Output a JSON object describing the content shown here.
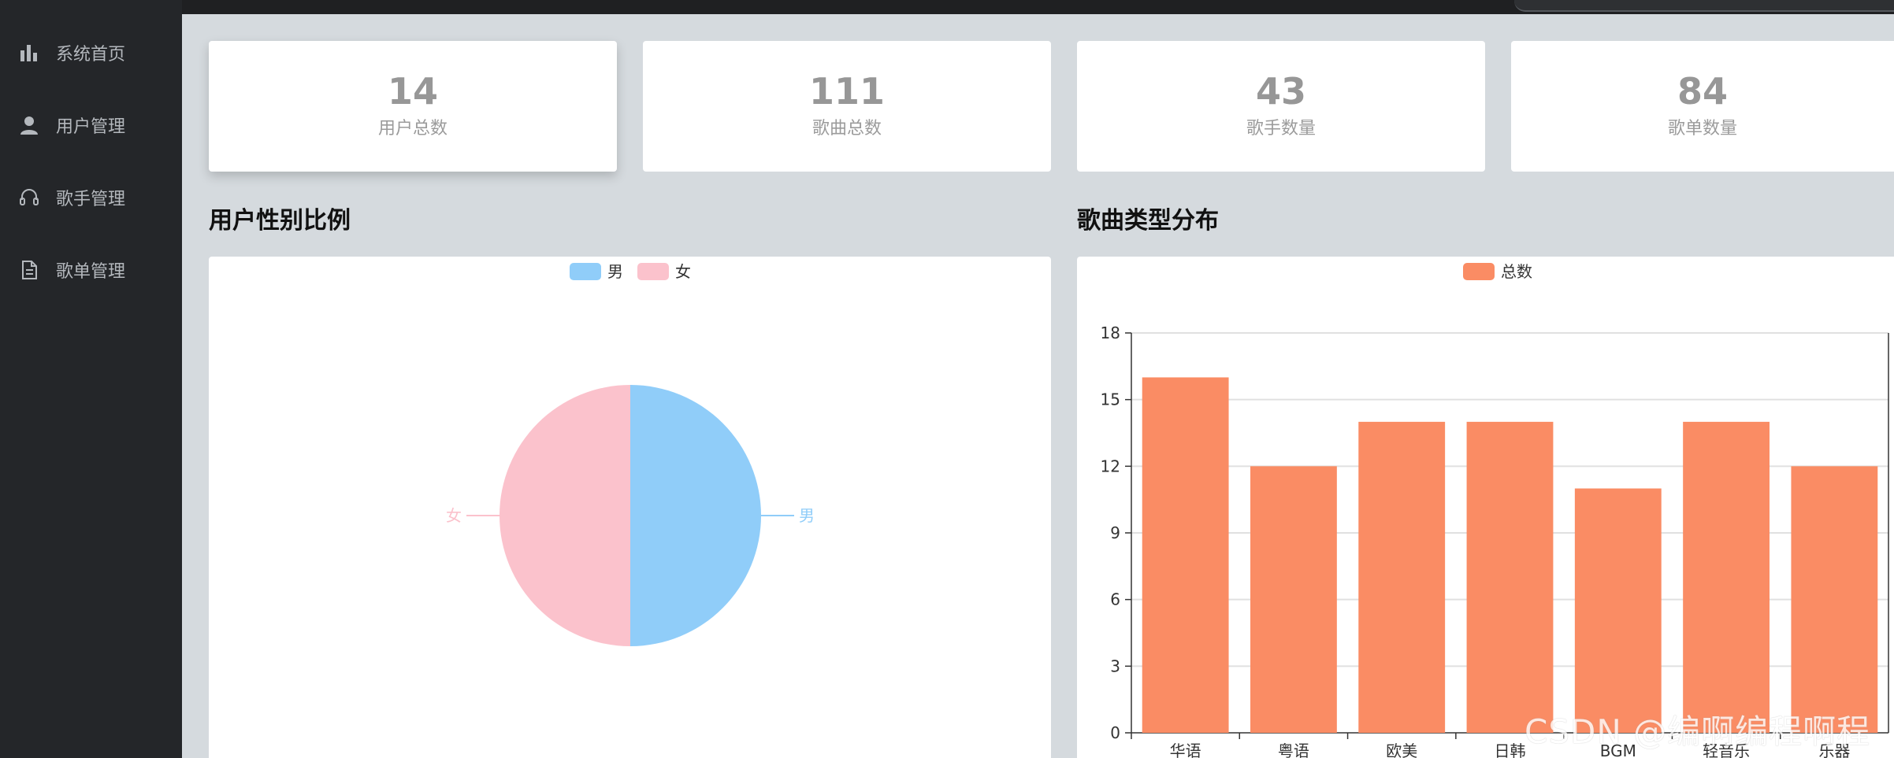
{
  "nav": {
    "items": [
      {
        "label": "系统首页",
        "icon": "bar-chart-icon"
      },
      {
        "label": "用户管理",
        "icon": "user-icon"
      },
      {
        "label": "歌手管理",
        "icon": "headset-icon"
      },
      {
        "label": "歌单管理",
        "icon": "document-icon"
      }
    ]
  },
  "stats": [
    {
      "value": "14",
      "label": "用户总数"
    },
    {
      "value": "111",
      "label": "歌曲总数"
    },
    {
      "value": "43",
      "label": "歌手数量"
    },
    {
      "value": "84",
      "label": "歌单数量"
    }
  ],
  "sections": {
    "gender_title": "用户性别比例",
    "genre_title": "歌曲类型分布"
  },
  "colors": {
    "male": "#90cdf9",
    "female": "#fbc2cc",
    "bar": "#fa8c64"
  },
  "chart_data": [
    {
      "type": "pie",
      "legend": [
        "男",
        "女"
      ],
      "labels": [
        "男",
        "女"
      ],
      "values": [
        1,
        1
      ],
      "legend_position": "top-center"
    },
    {
      "type": "bar",
      "legend": [
        "总数"
      ],
      "categories": [
        "华语",
        "粤语",
        "欧美",
        "日韩",
        "BGM",
        "轻音乐",
        "乐器"
      ],
      "series": [
        {
          "name": "总数",
          "values": [
            16,
            12,
            14,
            14,
            11,
            14,
            12
          ]
        }
      ],
      "ylim": [
        0,
        18
      ],
      "yticks": [
        0,
        3,
        6,
        9,
        12,
        15,
        18
      ],
      "grid": true,
      "legend_position": "top-center"
    }
  ],
  "watermark": "CSDN @编啊编程啊程"
}
